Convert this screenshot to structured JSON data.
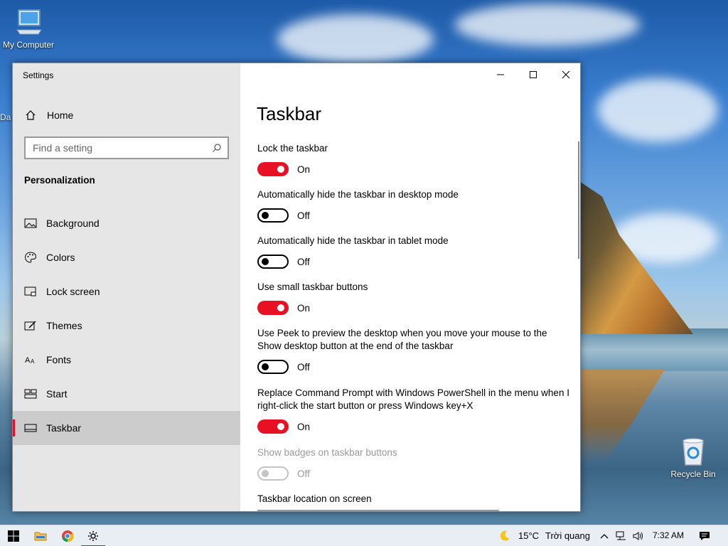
{
  "desktop": {
    "icons": [
      {
        "label": "My Computer",
        "icon": "computer-icon"
      },
      {
        "label": "Recycle Bin",
        "icon": "recycle-bin-icon"
      }
    ],
    "partial_label": "Da"
  },
  "window": {
    "title": "Settings",
    "minimize": "—",
    "maximize": "☐",
    "close": "✕"
  },
  "sidebar": {
    "home_label": "Home",
    "search_placeholder": "Find a setting",
    "section_title": "Personalization",
    "items": [
      {
        "label": "Background",
        "icon": "image-icon"
      },
      {
        "label": "Colors",
        "icon": "palette-icon"
      },
      {
        "label": "Lock screen",
        "icon": "lock-screen-icon"
      },
      {
        "label": "Themes",
        "icon": "brush-icon"
      },
      {
        "label": "Fonts",
        "icon": "font-icon"
      },
      {
        "label": "Start",
        "icon": "start-icon"
      },
      {
        "label": "Taskbar",
        "icon": "taskbar-icon",
        "active": true
      }
    ]
  },
  "main": {
    "title": "Taskbar",
    "settings": [
      {
        "label": "Lock the taskbar",
        "state": "On"
      },
      {
        "label": "Automatically hide the taskbar in desktop mode",
        "state": "Off"
      },
      {
        "label": "Automatically hide the taskbar in tablet mode",
        "state": "Off"
      },
      {
        "label": "Use small taskbar buttons",
        "state": "On"
      },
      {
        "label": "Use Peek to preview the desktop when you move your mouse to the Show desktop button at the end of the taskbar",
        "state": "Off"
      },
      {
        "label": "Replace Command Prompt with Windows PowerShell in the menu when I right-click the start button or press Windows key+X",
        "state": "On"
      },
      {
        "label": "Show badges on taskbar buttons",
        "state": "Off",
        "disabled": true
      }
    ],
    "location_label": "Taskbar location on screen"
  },
  "taskbar": {
    "weather_temp": "15°C",
    "weather_text": "Trời quang",
    "time": "7:32 AM",
    "colors": {
      "accent": "#e81123"
    }
  }
}
